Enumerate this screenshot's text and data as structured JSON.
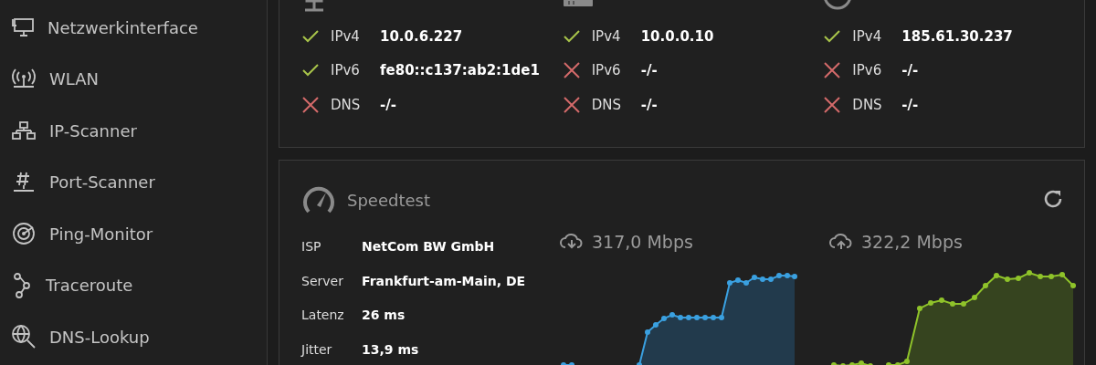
{
  "sidebar": {
    "items": [
      {
        "label": "Netzwerkinterface"
      },
      {
        "label": "WLAN"
      },
      {
        "label": "IP-Scanner"
      },
      {
        "label": "Port-Scanner"
      },
      {
        "label": "Ping-Monitor"
      },
      {
        "label": "Traceroute"
      },
      {
        "label": "DNS-Lookup"
      }
    ]
  },
  "interfaces": [
    {
      "rows": [
        {
          "label": "IPv4",
          "value": "10.0.6.227",
          "ok": true
        },
        {
          "label": "IPv6",
          "value": "fe80::c137:ab2:1de1",
          "ok": true
        },
        {
          "label": "DNS",
          "value": "-/-",
          "ok": false
        }
      ]
    },
    {
      "rows": [
        {
          "label": "IPv4",
          "value": "10.0.0.10",
          "ok": true
        },
        {
          "label": "IPv6",
          "value": "-/-",
          "ok": false
        },
        {
          "label": "DNS",
          "value": "-/-",
          "ok": false
        }
      ]
    },
    {
      "rows": [
        {
          "label": "IPv4",
          "value": "185.61.30.237",
          "ok": true
        },
        {
          "label": "IPv6",
          "value": "-/-",
          "ok": false
        },
        {
          "label": "DNS",
          "value": "-/-",
          "ok": false
        }
      ]
    }
  ],
  "speedtest": {
    "title": "Speedtest",
    "info": [
      {
        "label": "ISP",
        "value": "NetCom BW GmbH"
      },
      {
        "label": "Server",
        "value": "Frankfurt-am-Main, DE"
      },
      {
        "label": "Latenz",
        "value": "26 ms"
      },
      {
        "label": "Jitter",
        "value": "13,9 ms"
      }
    ],
    "download": {
      "reading": "317,0 Mbps"
    },
    "upload": {
      "reading": "322,2 Mbps"
    }
  }
}
